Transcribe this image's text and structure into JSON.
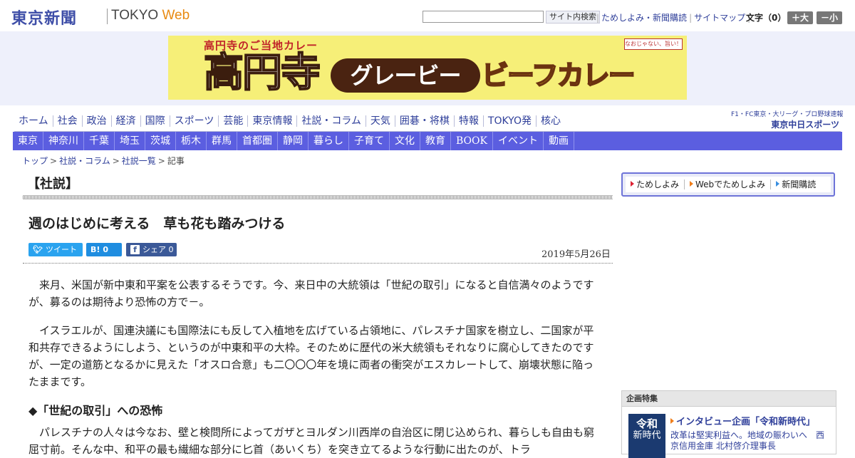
{
  "header": {
    "logo_jp": "東京新聞",
    "logo_en_main": "TOKYO",
    "logo_en_accent": "Web",
    "search_button": "サイト内検索",
    "links": [
      "ためしよみ・新聞購読",
      "サイトマップ"
    ],
    "font_size_label": "文字（0）",
    "font_bigger": "＋大",
    "font_smaller": "－小"
  },
  "ad": {
    "subtitle": "高円寺のご当地カレー",
    "word1": "高円寺",
    "word2": "グレービー",
    "word3": "ビーフカレー",
    "stamp": "なおじゃない、旨い！"
  },
  "nav_primary": [
    "ホーム",
    "社会",
    "政治",
    "経済",
    "国際",
    "スポーツ",
    "芸能",
    "東京情報",
    "社説・コラム",
    "天気",
    "囲碁・将棋",
    "特報",
    "TOKYO発",
    "核心"
  ],
  "chunichi": {
    "small": "F1・FC東京・大リーグ・プロ野球速報",
    "big": "東京中日スポーツ"
  },
  "nav_regional": [
    "東京",
    "神奈川",
    "千葉",
    "埼玉",
    "茨城",
    "栃木",
    "群馬",
    "首都圏",
    "静岡",
    "暮らし",
    "子育て",
    "文化",
    "教育",
    "BOOK",
    "イベント",
    "動画"
  ],
  "breadcrumb": {
    "items": [
      "トップ",
      "社説・コラム",
      "社説一覧"
    ],
    "current": "記事",
    "sep": ">"
  },
  "article": {
    "section": "【社説】",
    "title": "週のはじめに考える　草も花も踏みつける",
    "date": "2019年5月26日",
    "share": {
      "tweet": "ツイート",
      "hatena_icon": "B!",
      "hatena_count": "0",
      "fb_icon": "f",
      "fb_label": "シェア",
      "fb_count": "0"
    },
    "p1": "　来月、米国が新中東和平案を公表するそうです。今、来日中の大統領は「世紀の取引」になると自信満々のようですが、募るのは期待より恐怖の方で－。",
    "p2": "　イスラエルが、国連決議にも国際法にも反して入植地を広げている占領地に、パレスチナ国家を樹立し、二国家が平和共存できるようにしよう、というのが中東和平の大枠。そのために歴代の米大統領もそれなりに腐心してきたのですが、一定の道筋となるかに見えた「オスロ合意」も二〇〇〇年を境に両者の衝突がエスカレートして、崩壊状態に陥ったままです。",
    "subhead": "◆「世紀の取引」への恐怖",
    "p3": "　パレスチナの人々は今なお、壁と検問所によってガザとヨルダン川西岸の自治区に閉じ込められ、暮らしも自由も窮屈寸前。そんな中、和平の最も繊細な部分に匕首（あいくち）を突き立てるような行動に出たのが、トラ"
  },
  "sidebar": {
    "sub_links": [
      "ためしよみ",
      "Webでためしよみ",
      "新聞購読"
    ],
    "kikaku_head": "企画特集",
    "kikaku_img_1": "令和",
    "kikaku_img_2": "新時代",
    "kikaku_title": "インタビュー企画「令和新時代」",
    "kikaku_text": "改革は堅実利益へ。地域の賑わいへ　西京信用金庫 北村啓介理事長"
  },
  "colors": {
    "brand": "#3f4fa8",
    "nav_bar": "#5b5ee0",
    "accent_orange": "#e88a12"
  }
}
